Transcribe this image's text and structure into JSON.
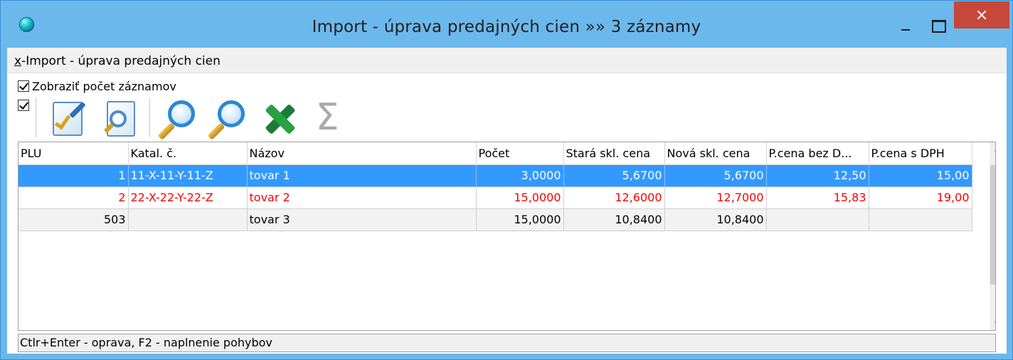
{
  "window": {
    "title": "Import - úprava predajných cien »» 3 záznamy"
  },
  "menu": {
    "accel": "x",
    "rest": "-Import - úprava predajných cien"
  },
  "options": {
    "show_count_label": "Zobraziť počet záznamov",
    "show_count_checked": true,
    "toolbar_checked": true
  },
  "toolbar": {
    "icons": [
      "edit-document-icon",
      "preview-document-icon",
      "search-icon",
      "search-next-icon",
      "excel-export-icon",
      "sum-icon"
    ]
  },
  "table": {
    "columns": [
      "PLU",
      "Katal. č.",
      "Názov",
      "Počet",
      "Stará skl. cena",
      "Nová skl. cena",
      "P.cena bez D...",
      "P.cena s DPH"
    ],
    "rows": [
      [
        "1",
        "11-X-11-Y-11-Z",
        "tovar 1",
        "3,0000",
        "5,6700",
        "5,6700",
        "12,50",
        "15,00"
      ],
      [
        "2",
        "22-X-22-Y-22-Z",
        "tovar 2",
        "15,0000",
        "12,6000",
        "12,7000",
        "15,83",
        "19,00"
      ],
      [
        "503",
        "",
        "tovar 3",
        "15,0000",
        "10,8400",
        "10,8400",
        "",
        ""
      ]
    ],
    "row_states": [
      "selected",
      "red",
      "gray"
    ]
  },
  "status": {
    "text": "Ctlr+Enter - oprava, F2 - naplnenie pohybov"
  },
  "colors": {
    "titlebar": "#6bb8ec",
    "close_button": "#c7473a",
    "selection": "#3399ff",
    "highlight_text": "#ff0000"
  }
}
